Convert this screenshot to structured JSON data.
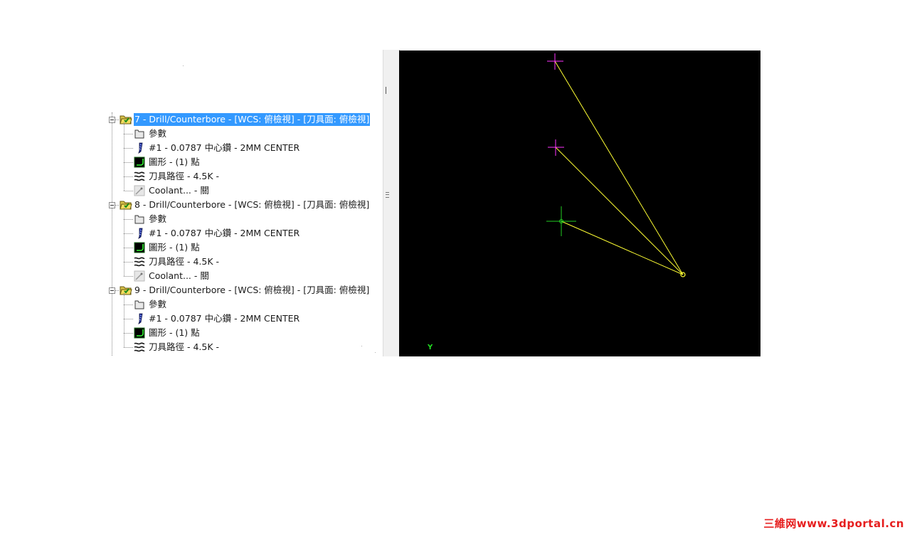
{
  "operations": [
    {
      "label": "7 - Drill/Counterbore - [WCS: 俯檢視] - [刀具面: 俯檢視]",
      "selected": true,
      "children": [
        {
          "icon": "folder-icon",
          "label": "參數"
        },
        {
          "icon": "drill-tool-icon",
          "label": "#1 - 0.0787 中心鑽 - 2MM CENTER"
        },
        {
          "icon": "geometry-icon",
          "label": "圖形 - (1) 點"
        },
        {
          "icon": "toolpath-icon",
          "label": "刀具路徑 - 4.5K -"
        },
        {
          "icon": "coolant-icon",
          "label": "Coolant... - 關"
        }
      ]
    },
    {
      "label": "8 - Drill/Counterbore - [WCS: 俯檢視] - [刀具面: 俯檢視]",
      "selected": false,
      "children": [
        {
          "icon": "folder-icon",
          "label": "參數"
        },
        {
          "icon": "drill-tool-icon",
          "label": "#1 - 0.0787 中心鑽 - 2MM CENTER"
        },
        {
          "icon": "geometry-icon",
          "label": "圖形 - (1) 點"
        },
        {
          "icon": "toolpath-icon",
          "label": "刀具路徑 - 4.5K -"
        },
        {
          "icon": "coolant-icon",
          "label": "Coolant... - 關"
        }
      ]
    },
    {
      "label": "9 - Drill/Counterbore - [WCS: 俯檢視] - [刀具面: 俯檢視]",
      "selected": false,
      "children": [
        {
          "icon": "folder-icon",
          "label": "參數"
        },
        {
          "icon": "drill-tool-icon",
          "label": "#1 - 0.0787 中心鑽 - 2MM CENTER"
        },
        {
          "icon": "geometry-icon",
          "label": "圖形 - (1) 點"
        },
        {
          "icon": "toolpath-icon",
          "label": "刀具路徑 - 4.5K -"
        }
      ]
    }
  ],
  "viewport": {
    "axis_label": "Y",
    "background": "#000000",
    "toolpath_color": "#ffff33",
    "point_color": "#ff33ff",
    "origin_color": "#22cc22"
  },
  "watermark": "三維网www.3dportal.cn"
}
